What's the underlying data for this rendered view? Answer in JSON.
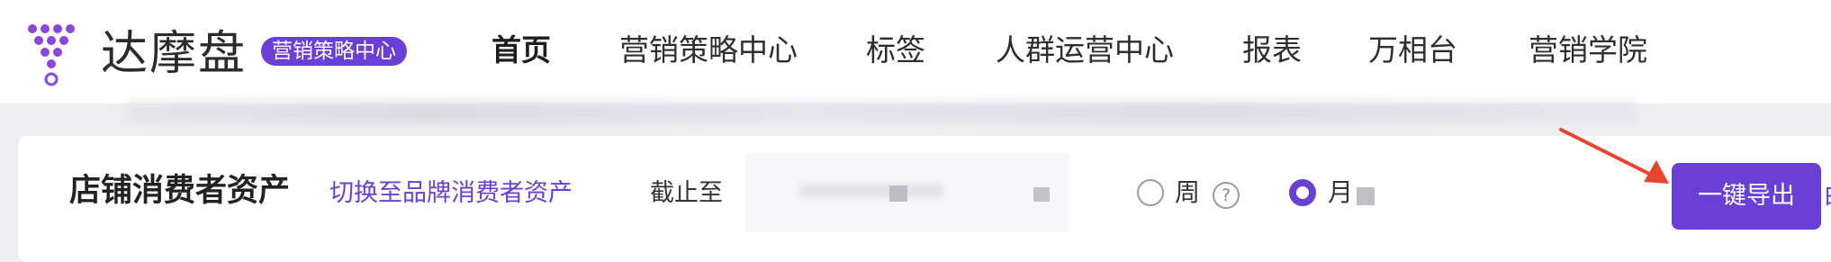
{
  "brand": {
    "name": "达摩盘",
    "badge": "营销策略中心",
    "accent": "#6a3fd6"
  },
  "nav": {
    "items": [
      {
        "label": "首页",
        "active": true
      },
      {
        "label": "营销策略中心"
      },
      {
        "label": "标签"
      },
      {
        "label": "人群运营中心"
      },
      {
        "label": "报表"
      },
      {
        "label": "万相台"
      },
      {
        "label": "营销学院"
      }
    ]
  },
  "page": {
    "title": "店铺消费者资产",
    "switch_link": "切换至品牌消费者资产",
    "date_label": "截止至",
    "date_value": ""
  },
  "period": {
    "week_label": "周",
    "month_label": "月",
    "selected": "月",
    "help_icon": "?"
  },
  "actions": {
    "export_label": "一键导出",
    "edge_text": "由"
  },
  "annotation": {
    "arrow_color": "#e8452f"
  }
}
